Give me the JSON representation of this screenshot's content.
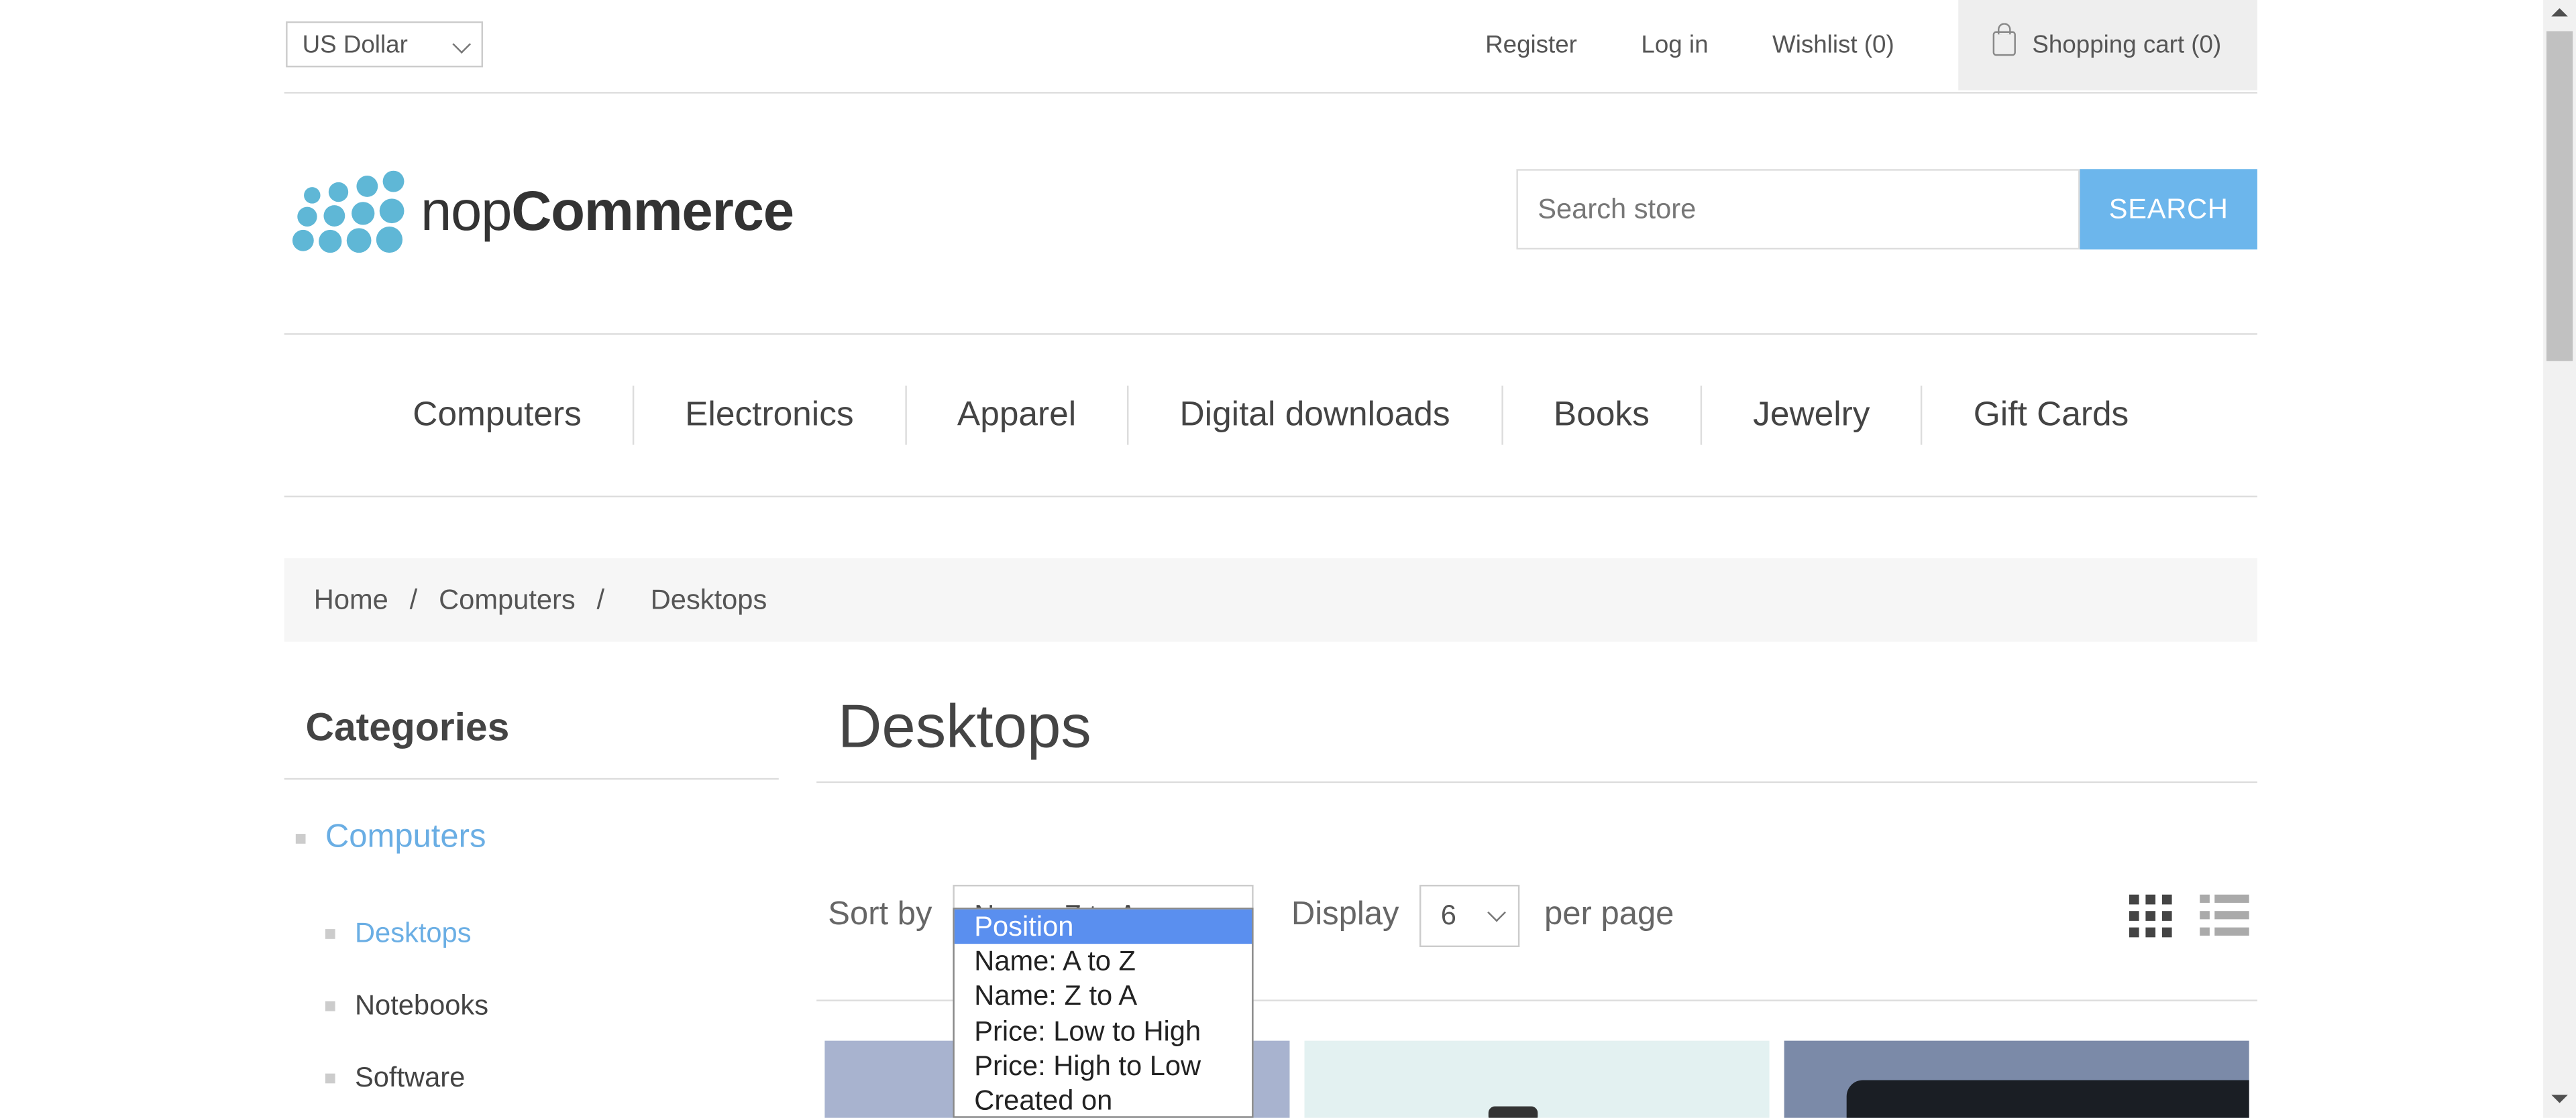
{
  "header": {
    "currency": "US Dollar",
    "links": {
      "register": "Register",
      "login": "Log in",
      "wishlist": "Wishlist (0)",
      "cart": "Shopping cart (0)"
    },
    "logo": {
      "text_light": "nop",
      "text_bold": "Commerce"
    },
    "search": {
      "placeholder": "Search store",
      "button": "SEARCH"
    }
  },
  "menu": [
    "Computers",
    "Electronics",
    "Apparel",
    "Digital downloads",
    "Books",
    "Jewelry",
    "Gift Cards"
  ],
  "breadcrumb": {
    "home": "Home",
    "sep": "/",
    "computers": "Computers",
    "current": "Desktops"
  },
  "sidebar": {
    "title": "Categories",
    "parent": "Computers",
    "children": [
      "Desktops",
      "Notebooks",
      "Software"
    ],
    "active_child": "Desktops"
  },
  "main": {
    "title": "Desktops",
    "sort_label": "Sort by",
    "sort_selected_partial": "Name: Z to A",
    "sort_options": [
      "Position",
      "Name: A to Z",
      "Name: Z to A",
      "Price: Low to High",
      "Price: High to Low",
      "Created on"
    ],
    "sort_highlighted": "Position",
    "display_label": "Display",
    "page_size": "6",
    "per_page_label": "per page"
  },
  "icons": {
    "grid_view": "grid-view-icon",
    "list_view": "list-view-icon",
    "cart": "shopping-bag-icon",
    "dropdown": "chevron-down-icon"
  },
  "colors": {
    "accent": "#6cb6ec",
    "link": "#6aaee4",
    "highlight": "#5a8fef",
    "logo_dots": "#5fb7d6"
  }
}
